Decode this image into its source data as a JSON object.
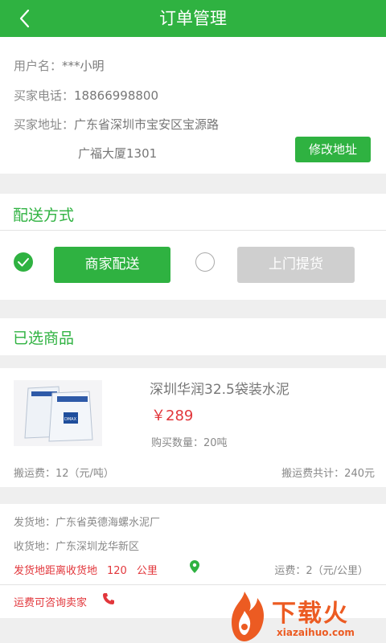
{
  "header": {
    "title": "订单管理"
  },
  "buyer": {
    "name_label": "用户名：",
    "name_value": "***小明",
    "phone_label": "买家电话：",
    "phone_value": "18866998800",
    "address_label": "买家地址：",
    "address_line1": "广东省深圳市宝安区宝源路",
    "address_line2": "广福大厦1301",
    "edit_button": "修改地址"
  },
  "delivery": {
    "title": "配送方式",
    "options": [
      {
        "label": "商家配送",
        "selected": true
      },
      {
        "label": "上门提货",
        "selected": false
      }
    ]
  },
  "selected": {
    "title": "已选商品",
    "product": {
      "name": "深圳华润32.5袋装水泥",
      "price": "￥289",
      "quantity": "购买数量：20吨",
      "handling_fee": "搬运费：12（元/吨）",
      "handling_total": "搬运费共计：240元",
      "image_brand": "DMAX"
    }
  },
  "shipping": {
    "origin": "发货地：广东省英德海螺水泥厂",
    "destination": "收货地：广东深圳龙华新区",
    "distance_label": "发货地距离收货地",
    "distance_value": "120",
    "distance_unit": "公里",
    "freight": "运费：2（元/公里）",
    "consult": "运费可咨询卖家"
  },
  "watermark": {
    "text": "下载火",
    "url": "xiazaihuo.com"
  },
  "colors": {
    "accent": "#2fb241",
    "price": "#e2363b",
    "watermark": "#ec5b22"
  }
}
